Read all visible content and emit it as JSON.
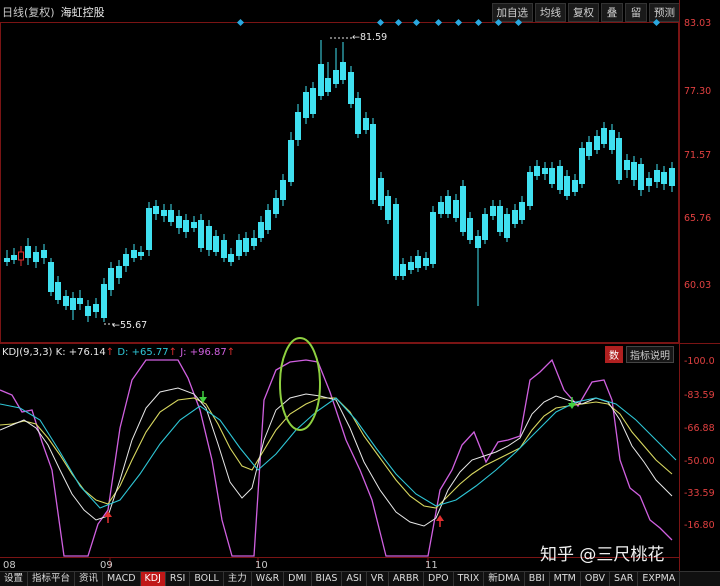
{
  "header": {
    "period": "日线(复权)",
    "stock_name": "海虹控股",
    "actions": [
      "加自选",
      "均线",
      "复权",
      "叠",
      "留",
      "预测"
    ]
  },
  "price_axis": [
    "83.03",
    "77.30",
    "71.57",
    "65.76",
    "60.03"
  ],
  "annotations": {
    "high": "81.59",
    "low": "55.67"
  },
  "kdj": {
    "title": "KDJ(9,3,3)",
    "k": "K: +76.14",
    "d": "D: +65.77",
    "j": "J: +96.87",
    "button_num": "数",
    "button_help": "指标说明",
    "axis": [
      "100.0",
      "83.59",
      "66.88",
      "50.00",
      "33.59",
      "16.80"
    ]
  },
  "dates": [
    "08",
    "09",
    "10",
    "11"
  ],
  "tabs": [
    "设置",
    "指标平台",
    "资讯",
    "MACD",
    "KDJ",
    "RSI",
    "BOLL",
    "主力",
    "W&R",
    "DMI",
    "BIAS",
    "ASI",
    "VR",
    "ARBR",
    "DPO",
    "TRIX",
    "新DMA",
    "BBI",
    "MTM",
    "OBV",
    "SAR",
    "EXPMA"
  ],
  "active_tab": "KDJ",
  "watermark": "知乎 @三尺桃花",
  "colors": {
    "up": "#e03030",
    "down": "#40e0f0",
    "k_line": "#e8e8e8",
    "d_line": "#d8d860",
    "j_line": "#d060e0",
    "ma_line": "#2ec6d6",
    "highlight_circle": "#8ed040"
  }
}
